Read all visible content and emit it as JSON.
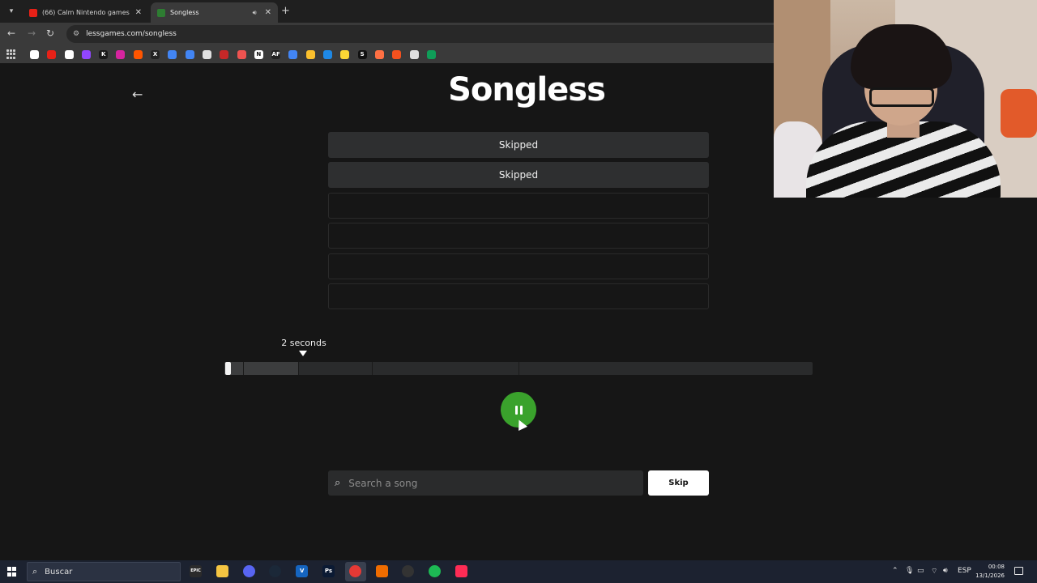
{
  "browser": {
    "tabs": [
      {
        "title": "(66) Calm Nintendo games mu",
        "favicon_color": "#e62117",
        "icon": "youtube-icon"
      },
      {
        "title": "Songless",
        "favicon_color": "#2e7d32",
        "icon": "songless-icon"
      }
    ],
    "url": "lessgames.com/songless",
    "bookmarks": [
      {
        "icon": "google-icon",
        "color": "#ffffff"
      },
      {
        "icon": "youtube-icon",
        "color": "#e62117"
      },
      {
        "icon": "gmail-icon",
        "color": "#ffffff"
      },
      {
        "icon": "twitch-icon",
        "color": "#9146ff"
      },
      {
        "icon": "kick-icon",
        "color": "#1a1a1a",
        "glyph": "K"
      },
      {
        "icon": "instagram-icon",
        "color": "#d6249f"
      },
      {
        "icon": "soundcloud-icon",
        "color": "#ff5500"
      },
      {
        "icon": "x-icon",
        "color": "#222222",
        "glyph": "X"
      },
      {
        "icon": "translate-icon",
        "color": "#4285f4"
      },
      {
        "icon": "drive-icon",
        "color": "#4285f4"
      },
      {
        "icon": "layers-icon",
        "color": "#e0e0e0"
      },
      {
        "icon": "red-square-icon",
        "color": "#c62828"
      },
      {
        "icon": "tag-icon",
        "color": "#ef5350"
      },
      {
        "icon": "notion-icon",
        "color": "#ffffff",
        "glyph": "N"
      },
      {
        "icon": "af-icon",
        "color": "#222222",
        "glyph": "AF"
      },
      {
        "icon": "translate-2-icon",
        "color": "#4285f4"
      },
      {
        "icon": "yellow-icon",
        "color": "#fbc02d"
      },
      {
        "icon": "wiki-icon",
        "color": "#1e88e5"
      },
      {
        "icon": "coin-icon",
        "color": "#fdd835"
      },
      {
        "icon": "s-icon",
        "color": "#111111",
        "glyph": "S"
      },
      {
        "icon": "circle-icon",
        "color": "#ff7043"
      },
      {
        "icon": "orange-icon",
        "color": "#f4511e"
      },
      {
        "icon": "podcast-icon",
        "color": "#e0e0e0"
      },
      {
        "icon": "sheets-icon",
        "color": "#0f9d58"
      }
    ]
  },
  "songless": {
    "title": "Songless",
    "guesses": [
      "Skipped",
      "Skipped",
      "",
      "",
      "",
      ""
    ],
    "duration_label": "2 seconds",
    "snippet_segments_seconds": [
      0.1,
      0.5,
      2,
      4,
      8,
      16
    ],
    "snippet_total_seconds": 16,
    "current_snippet_seconds": 2,
    "search_placeholder": "Search a song",
    "skip_label": "Skip",
    "accent_color": "#3aa22c"
  },
  "taskbar": {
    "search_label": "Buscar",
    "apps": [
      {
        "icon": "epic-icon",
        "color": "#2b2b2b",
        "glyph": "EPIC"
      },
      {
        "icon": "folder-icon",
        "color": "#f4c542"
      },
      {
        "icon": "discord-icon",
        "color": "#5865f2"
      },
      {
        "icon": "steam-icon",
        "color": "#1b2838"
      },
      {
        "icon": "vegas-icon",
        "color": "#1565c0",
        "glyph": "V"
      },
      {
        "icon": "photoshop-icon",
        "color": "#0b1a33",
        "glyph": "Ps"
      },
      {
        "icon": "chrome-icon",
        "color": "#e53935"
      },
      {
        "icon": "fl-studio-icon",
        "color": "#ef6c00"
      },
      {
        "icon": "obs-icon",
        "color": "#333333"
      },
      {
        "icon": "spotify-icon",
        "color": "#1db954"
      },
      {
        "icon": "tiktok-icon",
        "color": "#fe2c55"
      }
    ],
    "language": "ESP",
    "time": "00:08",
    "date": "13/1/2026"
  }
}
